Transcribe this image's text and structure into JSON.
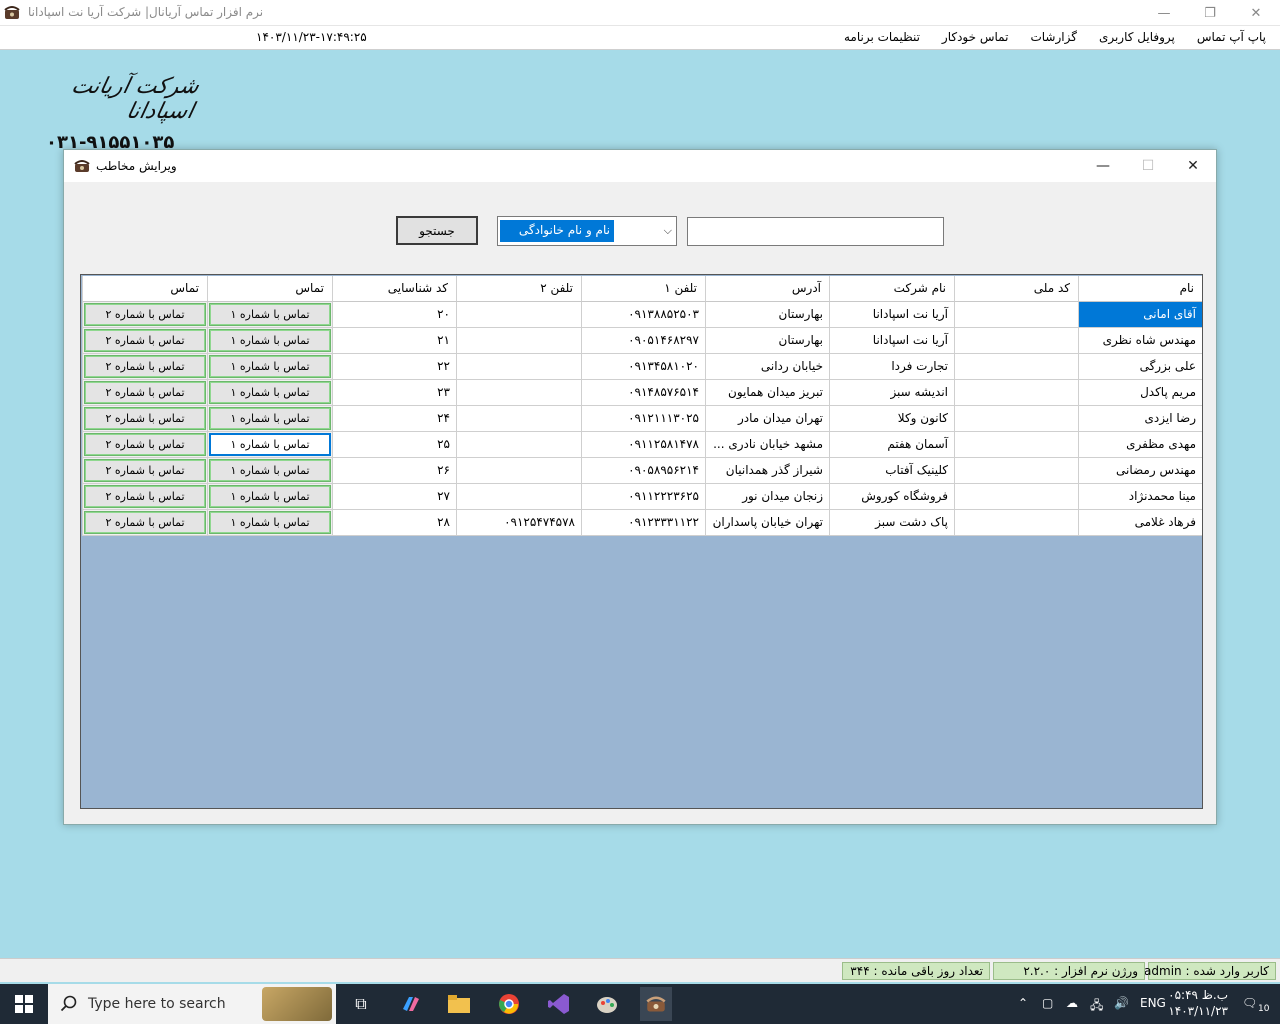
{
  "window": {
    "title": "نرم افزار تماس آریانال| شرکت آریا نت اسپادانا",
    "minimize_glyph": "—",
    "maximize_glyph": "❐",
    "close_glyph": "✕"
  },
  "menubar": {
    "clock": "۱۴۰۳/۱۱/۲۳-۱۷:۴۹:۲۵",
    "items": [
      "تنظیمات برنامه",
      "تماس خودکار",
      "گزارشات",
      "پروفایل کاربری",
      "پاپ آپ تماس"
    ]
  },
  "logo": {
    "company": "شرکت آریانت اسپادانا",
    "phone": "۰۳۱-۹۱۵۵۱۰۳۵"
  },
  "dialog": {
    "title": "ویرایش مخاطب",
    "search_button": "جستجو",
    "search_field_option": "نام و نام خانوادگی",
    "search_value": ""
  },
  "grid": {
    "columns": [
      "نام",
      "کد ملی",
      "نام شرکت",
      "آدرس",
      "تلفن ۱",
      "تلفن ۲",
      "کد شناسایی",
      "تماس",
      "تماس"
    ],
    "call1_label": "تماس با شماره ۱",
    "call2_label": "تماس با شماره ۲",
    "rows": [
      {
        "name": "آقای امانی",
        "national_id": "",
        "company": "آریا نت اسپادانا",
        "address": "بهارستان",
        "phone1": "۰۹۱۳۸۸۵۲۵۰۳",
        "phone2": "",
        "code": "۲۰"
      },
      {
        "name": "مهندس شاه نظری",
        "national_id": "",
        "company": "آریا نت اسپادانا",
        "address": "بهارستان",
        "phone1": "۰۹۰۵۱۴۶۸۲۹۷",
        "phone2": "",
        "code": "۲۱"
      },
      {
        "name": "علی بزرگی",
        "national_id": "",
        "company": "تجارت فردا",
        "address": "خیابان ردانی",
        "phone1": "۰۹۱۳۴۵۸۱۰۲۰",
        "phone2": "",
        "code": "۲۲"
      },
      {
        "name": "مریم پاکدل",
        "national_id": "",
        "company": "اندیشه سبز",
        "address": "تبریز میدان همایون",
        "phone1": "۰۹۱۴۸۵۷۶۵۱۴",
        "phone2": "",
        "code": "۲۳"
      },
      {
        "name": "رضا ایزدی",
        "national_id": "",
        "company": "کانون وکلا",
        "address": "تهران میدان مادر",
        "phone1": "۰۹۱۲۱۱۱۳۰۲۵",
        "phone2": "",
        "code": "۲۴"
      },
      {
        "name": "مهدی مظفری",
        "national_id": "",
        "company": "آسمان هفتم",
        "address": "مشهد خیابان نادری ...",
        "phone1": "۰۹۱۱۲۵۸۱۴۷۸",
        "phone2": "",
        "code": "۲۵"
      },
      {
        "name": "مهندس رمضانی",
        "national_id": "",
        "company": "کلینیک آفتاب",
        "address": "شیراز گذر همدانیان",
        "phone1": "۰۹۰۵۸۹۵۶۲۱۴",
        "phone2": "",
        "code": "۲۶"
      },
      {
        "name": "مینا محمدنژاد",
        "national_id": "",
        "company": "فروشگاه کوروش",
        "address": "زنجان میدان نور",
        "phone1": "۰۹۱۱۲۲۲۳۶۲۵",
        "phone2": "",
        "code": "۲۷"
      },
      {
        "name": "فرهاد غلامی",
        "national_id": "",
        "company": "پاک دشت سبز",
        "address": "تهران خیابان پاسداران",
        "phone1": "۰۹۱۲۳۳۳۱۱۲۲",
        "phone2": "۰۹۱۲۵۴۷۴۵۷۸",
        "code": "۲۸"
      }
    ]
  },
  "statusbar": {
    "user": "کاربر وارد شده : admin",
    "version": "ورژن نرم افزار : ۲.۲.۰",
    "days_left": "تعداد روز باقی مانده : ۳۴۴"
  },
  "taskbar": {
    "search_placeholder": "Type here to search",
    "lang": "ENG",
    "time": "ب.ظ ۰۵:۴۹",
    "date": "۱۴۰۳/۱۱/۲۳",
    "notification_count": "10"
  }
}
